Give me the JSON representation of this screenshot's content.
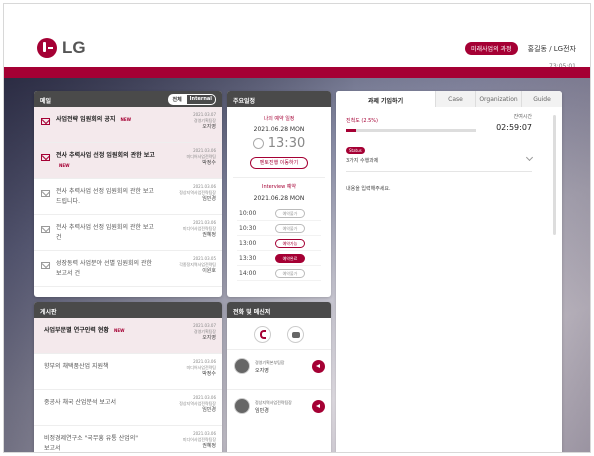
{
  "header": {
    "logo_text": "LG",
    "badge": "미래사업의 과정",
    "user": "홍길동 / LG전자",
    "clock": "73:05:01"
  },
  "mail_panel": {
    "title": "메일",
    "toggle_on": "전체",
    "toggle_off": "Internal",
    "items": [
      {
        "title": "사업전략 임원회의 공지",
        "new": "NEW",
        "date": "2021.03.07",
        "dept": "경영기획팀장",
        "name": "오지영",
        "highlight": true
      },
      {
        "title": "전사 추력사업 선정 임원회의 관한 보고",
        "new": "NEW",
        "date": "2021.03.06",
        "dept": "미디어사업전략팀",
        "name": "박정수",
        "highlight": true
      },
      {
        "title": "전사 추력사업 선정 임원회의 관한 보고 드립니다.",
        "new": "",
        "date": "2021.03.06",
        "dept": "정상지역사업전략팀장",
        "name": "임민경",
        "highlight": false
      },
      {
        "title": "전사 추력사업 선정 임원회의 관한 보고 건",
        "new": "",
        "date": "2021.03.06",
        "dept": "미디어사업전략팀장",
        "name": "권혜정",
        "highlight": false
      },
      {
        "title": "성장동력 사업분야 선별 임원회의 관한 보고서 건",
        "new": "",
        "date": "2021.03.05",
        "dept": "각종정지역사업전략팀",
        "name": "이원호",
        "highlight": false
      }
    ]
  },
  "board_panel": {
    "title": "게시판",
    "items": [
      {
        "title": "사업부문별 연구인력 현황",
        "new": "NEW",
        "date": "2021.03.07",
        "dept": "경영기획팀장",
        "name": "오지영",
        "highlight": true
      },
      {
        "title": "향부의 채택품산업 지원책",
        "new": "",
        "date": "2021.03.06",
        "dept": "미디어사업전략팀",
        "name": "박정수",
        "highlight": false
      },
      {
        "title": "중공사 채국 산업분석 보고서",
        "new": "",
        "date": "2021.03.06",
        "dept": "정상지역사업전략팀장",
        "name": "임민경",
        "highlight": false
      },
      {
        "title": "비정경제연구소 \"국무흥 유통 산업의\" 보고서",
        "new": "",
        "date": "2021.03.06",
        "dept": "미디어사업전략팀장",
        "name": "권혜정",
        "highlight": false
      }
    ]
  },
  "schedule_panel": {
    "title": "주요일정",
    "my_schedule_label": "나의 예약 일정",
    "date": "2021.06.28 MON",
    "time": "13:30",
    "project_button": "멘토진행 이동하기",
    "interview_label": "Interview 예약",
    "interview_date": "2021.06.28 MON",
    "slots": [
      {
        "time": "10:00",
        "status": "예약불가",
        "style": "grey"
      },
      {
        "time": "10:30",
        "status": "예약불가",
        "style": "grey"
      },
      {
        "time": "13:00",
        "status": "예약가능",
        "style": "red"
      },
      {
        "time": "13:30",
        "status": "예약완료",
        "style": "fill"
      },
      {
        "time": "14:00",
        "status": "예약불가",
        "style": "grey"
      }
    ]
  },
  "task_panel": {
    "tabs": [
      "과제 기입하기",
      "Case",
      "Organization",
      "Guide"
    ],
    "progress_label": "진척도 (2.5%)",
    "progress_value": 2.5,
    "remain_label": "잔여시간",
    "remain_time": "02:59:07",
    "status_chip": "Status",
    "stage": "3가지 수행과제",
    "content_placeholder": "내용을 입력해주세요."
  },
  "call_panel": {
    "title": "전화 및 메신저",
    "people": [
      {
        "dept": "경영기획본부팀장",
        "name": "오지영"
      },
      {
        "dept": "정상지역사업전략팀장",
        "name": "임민경"
      }
    ]
  },
  "colors": {
    "accent": "#a50034",
    "panel_head": "#4a4a4a"
  }
}
